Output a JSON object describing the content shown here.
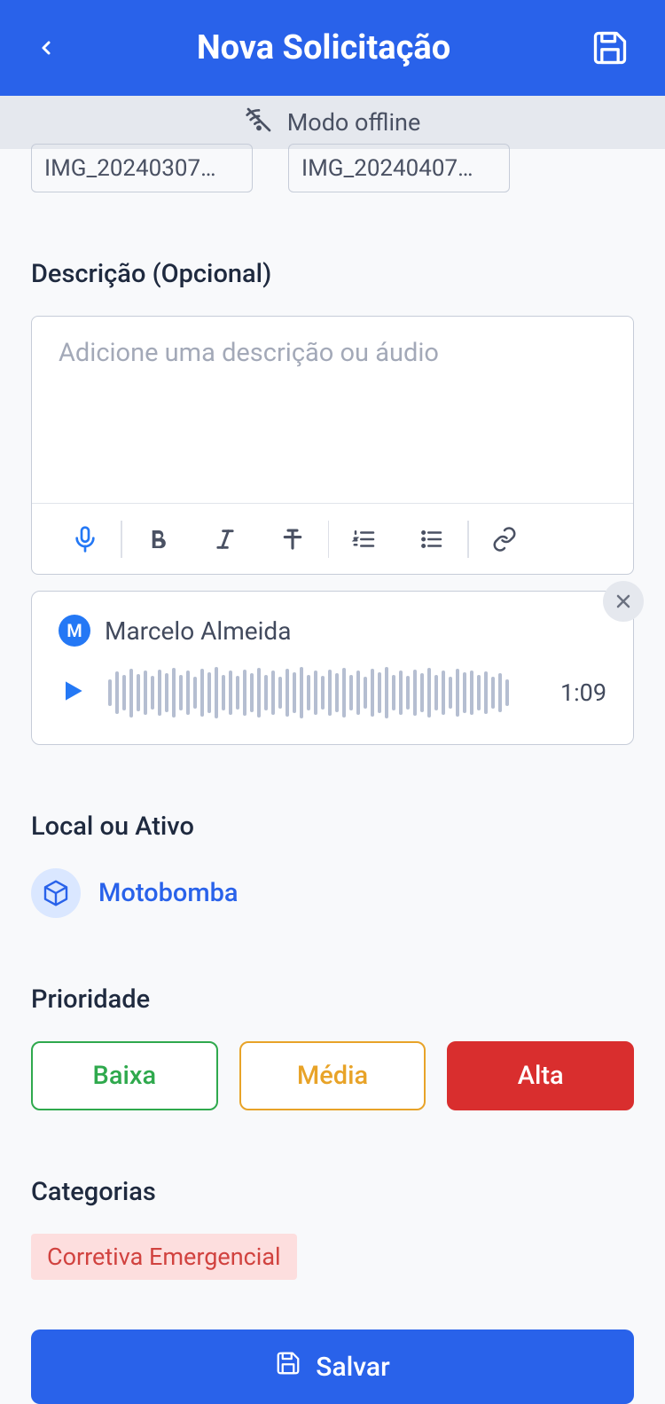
{
  "header": {
    "title": "Nova Solicitação"
  },
  "offline": {
    "label": "Modo offline"
  },
  "attachments": {
    "items": [
      {
        "name": "IMG_20240307…"
      },
      {
        "name": "IMG_20240407…"
      }
    ]
  },
  "description": {
    "label": "Descrição (Opcional)",
    "placeholder": "Adicione uma descrição ou áudio"
  },
  "audio": {
    "user_initial": "M",
    "user_name": "Marcelo Almeida",
    "duration": "1:09"
  },
  "location": {
    "label": "Local ou Ativo",
    "value": "Motobomba"
  },
  "priority": {
    "label": "Prioridade",
    "options": {
      "low": "Baixa",
      "medium": "Média",
      "high": "Alta"
    },
    "selected": "high"
  },
  "categories": {
    "label": "Categorias",
    "tag": "Corretiva Emergencial"
  },
  "save_button": {
    "label": "Salvar"
  }
}
